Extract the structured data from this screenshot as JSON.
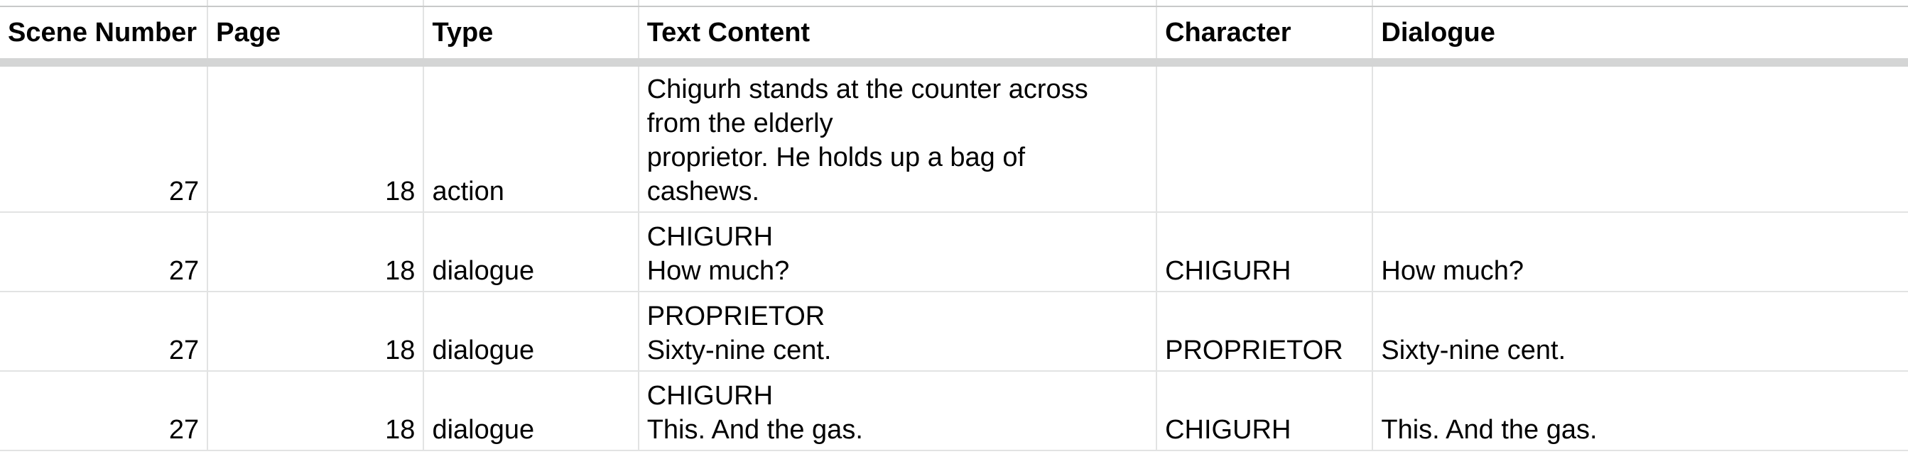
{
  "sheet": {
    "columns": [
      {
        "label": "Scene Number"
      },
      {
        "label": "Page"
      },
      {
        "label": "Type"
      },
      {
        "label": "Text Content"
      },
      {
        "label": "Character"
      },
      {
        "label": "Dialogue"
      }
    ],
    "rows": [
      {
        "scene": "27",
        "page": "18",
        "type": "action",
        "text_lines": [
          "Chigurh stands at the counter across",
          "from the elderly",
          "proprietor. He holds up a bag of",
          "cashews."
        ],
        "character": "",
        "dialogue": ""
      },
      {
        "scene": "27",
        "page": "18",
        "type": "dialogue",
        "text_lines": [
          "CHIGURH",
          "How much?"
        ],
        "character": "CHIGURH",
        "dialogue": "How much?"
      },
      {
        "scene": "27",
        "page": "18",
        "type": "dialogue",
        "text_lines": [
          "PROPRIETOR",
          "Sixty-nine cent."
        ],
        "character": "PROPRIETOR",
        "dialogue": "Sixty-nine cent."
      },
      {
        "scene": "27",
        "page": "18",
        "type": "dialogue",
        "text_lines": [
          "CHIGURH",
          "This. And the gas."
        ],
        "character": "CHIGURH",
        "dialogue": "This. And the gas."
      }
    ]
  }
}
